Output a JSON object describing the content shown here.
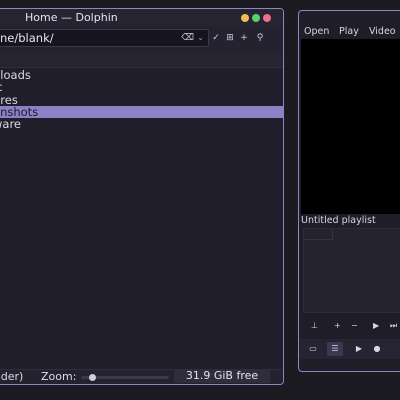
{
  "dolphin": {
    "title": "Home — Dolphin",
    "location_path": "ne/blank/",
    "toolbar_icons": [
      "clear-icon",
      "dropdown-icon",
      "check-icon",
      "grid-icon",
      "plus-icon",
      "search-icon"
    ],
    "files": [
      "nloads",
      "ic",
      "ures",
      "enshots",
      "ware"
    ],
    "selected_file": "enshots",
    "status_text": "older)",
    "zoom_label": "Zoom:",
    "zoom_level": 0.12,
    "free_space": "31.9 GiB free"
  },
  "player": {
    "menu": [
      "Open",
      "Play",
      "Video"
    ],
    "playlist_title": "Untitled playlist",
    "controls": [
      "add-icon",
      "plus-icon",
      "minus-icon",
      "play-icon",
      "next-icon"
    ],
    "bottom_buttons": [
      "playlist-icon",
      "list-icon",
      "play-icon",
      "record-icon"
    ]
  },
  "colors": {
    "accent": "#8b81c5",
    "border": "#8f86c2",
    "background": "#1c1b22",
    "min_button": "#f7b955",
    "max_button": "#5ccf6b",
    "close_button": "#f06e8f"
  }
}
